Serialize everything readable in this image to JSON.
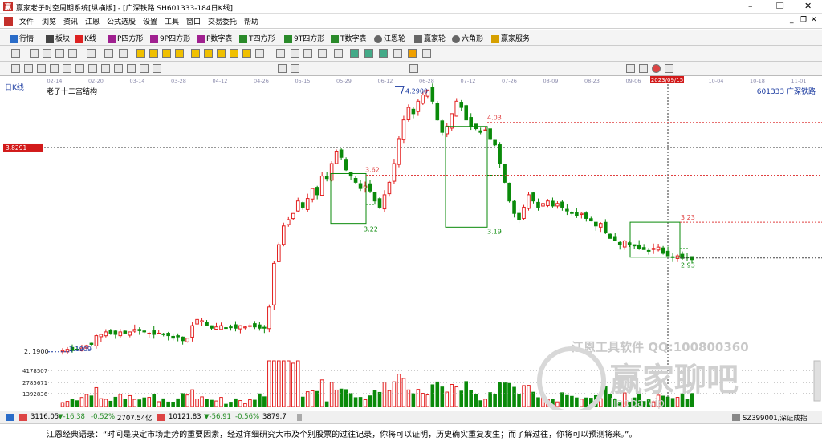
{
  "window": {
    "title": "赢家老子时空周期系统[纵横版] - [广深铁路  SH601333-184日K线]",
    "controls": [
      "–",
      "❐",
      "✕"
    ],
    "inner_controls": [
      "_",
      "❐",
      "✕"
    ]
  },
  "menu": [
    "文件",
    "浏览",
    "资讯",
    "江恩",
    "公式选股",
    "设置",
    "工具",
    "窗口",
    "交易委托",
    "帮助"
  ],
  "toolbar1": [
    {
      "label": "行情",
      "color": "#2a6cc8"
    },
    {
      "label": "板块",
      "color": "#444"
    },
    {
      "label": "K线",
      "color": "#d22"
    },
    {
      "label": "P四方形",
      "color": "#a02090"
    },
    {
      "label": "9P四方形",
      "color": "#a02090"
    },
    {
      "label": "P数字表",
      "color": "#a02090"
    },
    {
      "label": "T四方形",
      "color": "#2a8a2a"
    },
    {
      "label": "9T四方形",
      "color": "#2a8a2a"
    },
    {
      "label": "T数字表",
      "color": "#2a8a2a"
    },
    {
      "label": "江恩轮",
      "color": "#666"
    },
    {
      "label": "赢家轮",
      "color": "#666"
    },
    {
      "label": "六角形",
      "color": "#666"
    },
    {
      "label": "赢家服务",
      "color": "#d6a000"
    }
  ],
  "chart_info": {
    "period_label": "日K线",
    "structure_label": "老子十二宫结构",
    "stock_label": "601333  广深铁路",
    "price_marker": "3.8291",
    "crosshair_date": "2023/09/15",
    "date_ticks": [
      "02-14",
      "02-20",
      "03-14",
      "03-28",
      "04-12",
      "04-26",
      "05-15",
      "05-29",
      "06-12",
      "06-28",
      "07-12",
      "07-26",
      "08-09",
      "08-23",
      "09-06",
      "09-20",
      "10-04",
      "10-18",
      "11-01"
    ]
  },
  "chart_data": {
    "type": "candlestick",
    "title": "老子十二宫结构",
    "subtitle": "601333 广深铁路",
    "x_tick_labels": [
      "02-14",
      "02-20",
      "03-14",
      "03-28",
      "04-12",
      "04-26",
      "05-15",
      "05-29",
      "06-12",
      "06-28",
      "07-12",
      "07-26",
      "08-09",
      "08-23",
      "09-06",
      "09-20",
      "10-04",
      "10-18",
      "11-01"
    ],
    "y_range": [
      2.15,
      4.35
    ],
    "close_prices": [
      2.2,
      2.21,
      2.2,
      2.21,
      2.22,
      2.24,
      2.25,
      2.32,
      2.33,
      2.35,
      2.34,
      2.33,
      2.35,
      2.34,
      2.35,
      2.37,
      2.36,
      2.35,
      2.34,
      2.33,
      2.34,
      2.33,
      2.32,
      2.3,
      2.31,
      2.28,
      2.3,
      2.4,
      2.45,
      2.44,
      2.4,
      2.38,
      2.39,
      2.4,
      2.38,
      2.39,
      2.38,
      2.4,
      2.39,
      2.4,
      2.39,
      2.38,
      2.38,
      2.55,
      2.9,
      3.05,
      3.2,
      3.25,
      3.3,
      3.4,
      3.35,
      3.42,
      3.5,
      3.45,
      3.6,
      3.58,
      3.7,
      3.8,
      3.75,
      3.65,
      3.6,
      3.55,
      3.5,
      3.52,
      3.48,
      3.4,
      3.35,
      3.45,
      3.55,
      3.7,
      3.9,
      4.05,
      4.15,
      4.1,
      4.2,
      4.25,
      4.29,
      4.2,
      4.05,
      3.95,
      4.0,
      4.1,
      4.2,
      4.15,
      4.05,
      4.0,
      3.98,
      3.95,
      3.97,
      3.9,
      3.85,
      3.7,
      3.55,
      3.4,
      3.3,
      3.25,
      3.35,
      3.45,
      3.4,
      3.35,
      3.38,
      3.4,
      3.36,
      3.38,
      3.35,
      3.32,
      3.3,
      3.28,
      3.3,
      3.26,
      3.24,
      3.2,
      3.22,
      3.15,
      3.1,
      3.08,
      3.05,
      3.08,
      3.05,
      3.04,
      3.02,
      3.01,
      3.0,
      3.02,
      3.03,
      2.98,
      2.96,
      2.95,
      2.96,
      2.94,
      2.95,
      2.93
    ],
    "volumes_scale": 4178507,
    "annotations": [
      {
        "text": "4.2900",
        "price": 4.29
      },
      {
        "text": "4.03",
        "price": 4.03
      },
      {
        "text": "3.62",
        "price": 3.62
      },
      {
        "text": "3.22",
        "price": 3.22
      },
      {
        "text": "3.19",
        "price": 3.19
      },
      {
        "text": "3.23",
        "price": 3.23
      },
      {
        "text": "2.93",
        "price": 2.93
      },
      {
        "text": "2.1909",
        "price": 2.19
      }
    ],
    "y_label_markers": [
      {
        "text": "3.8291",
        "price": 3.8291
      },
      {
        "text": "2. 1900",
        "price": 2.19
      }
    ],
    "volume_ticks": [
      "4178507",
      "2785671",
      "1392836"
    ]
  },
  "watermark": {
    "line1": "江恩工具软件  QQ:100800360",
    "line2": "赢家聊吧",
    "line3": "liaoba.vip"
  },
  "bottom_bar": {
    "sh_index": "3116.05",
    "sh_change": "▼-16.38",
    "sh_pct": "-0.52%",
    "sh_amount": "2707.54亿",
    "sz_index": "10121.83",
    "sz_change": "▼-56.91",
    "sz_pct": "-0.56%",
    "sz_amount": "3879.7",
    "right_label": "SZ399001,深证成指"
  },
  "footer_text": "江恩经典语录：“时间是决定市场走势的重要因素，经过详细研究大市及个别股票的过往记录，你将可以证明，历史确实重复发生；而了解过往，你将可以预测将来。”。"
}
